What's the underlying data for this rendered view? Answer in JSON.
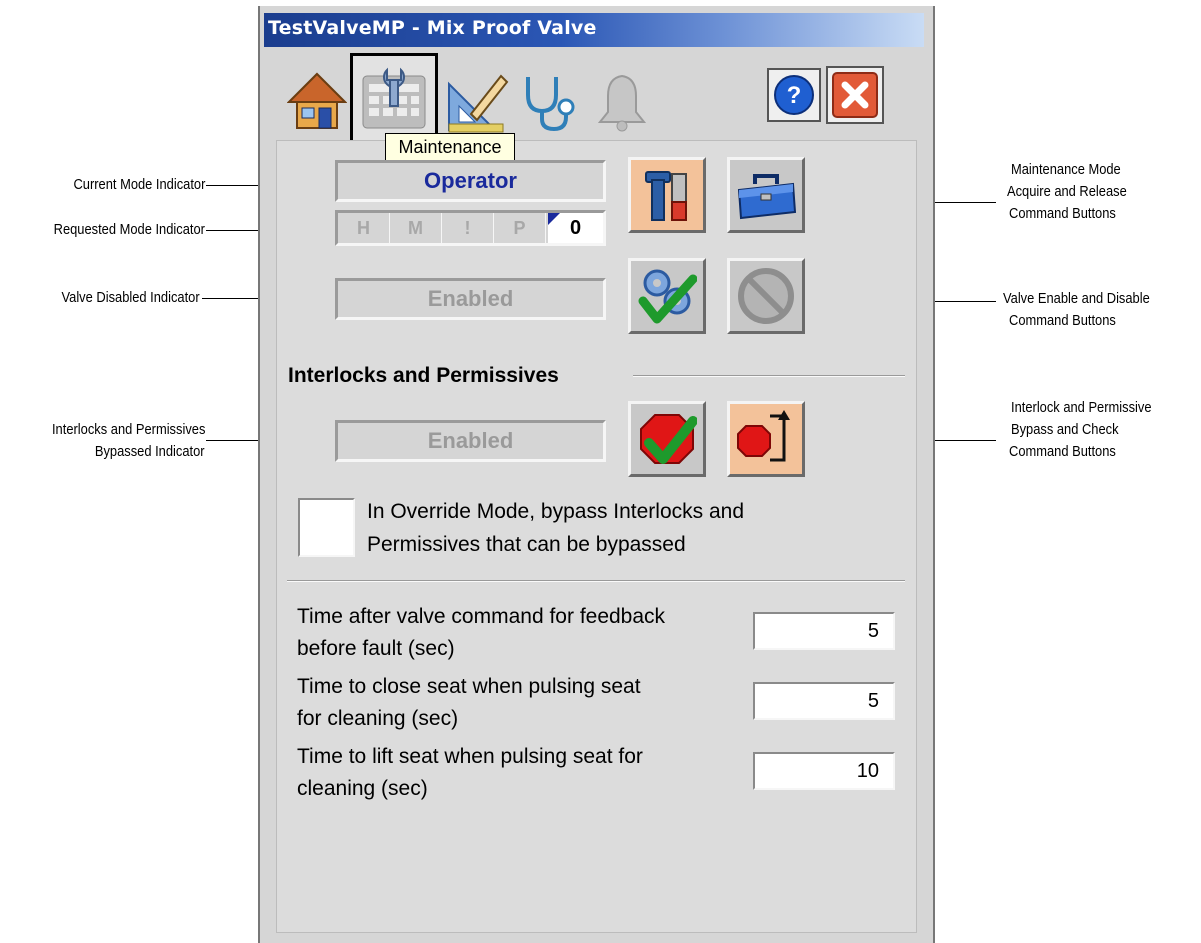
{
  "window": {
    "title": "TestValveMP - Mix Proof Valve"
  },
  "tabs": [
    {
      "name": "home",
      "icon": "home-icon"
    },
    {
      "name": "maintenance",
      "icon": "maintenance-icon",
      "selected": true
    },
    {
      "name": "engineering",
      "icon": "engineering-icon"
    },
    {
      "name": "diagnostics",
      "icon": "stethoscope-icon"
    },
    {
      "name": "alarms",
      "icon": "bell-icon"
    }
  ],
  "tooltip": "Maintenance",
  "mode": {
    "current": "Operator",
    "requested": {
      "cells": [
        "H",
        "M",
        "!",
        "P"
      ],
      "value": "0"
    }
  },
  "valve": {
    "status": "Enabled"
  },
  "interlocks": {
    "heading": "Interlocks and Permissives",
    "status": "Enabled",
    "override_label_line1": "In Override Mode, bypass Interlocks and",
    "override_label_line2": "Permissives that can be bypassed",
    "override_checked": false
  },
  "config": [
    {
      "label_line1": "Time after valve command for feedback",
      "label_line2": "before fault (sec)",
      "value": "5"
    },
    {
      "label_line1": "Time to close seat when pulsing seat",
      "label_line2": "for cleaning (sec)",
      "value": "5"
    },
    {
      "label_line1": "Time to lift seat when pulsing seat for",
      "label_line2": "cleaning (sec)",
      "value": "10"
    }
  ],
  "callouts": {
    "current_mode": "Current Mode Indicator",
    "requested_mode": "Requested Mode Indicator",
    "valve_disabled": "Valve Disabled Indicator",
    "bypassed_line1": "Interlocks and Permissives",
    "bypassed_line2": "Bypassed Indicator",
    "maint_line1": "Maintenance Mode",
    "maint_line2": "Acquire and Release",
    "maint_line3": "Command Buttons",
    "enable_line1": "Valve Enable and Disable",
    "enable_line2": "Command Buttons",
    "bypass_line1": "Interlock and Permissive",
    "bypass_line2": "Bypass and Check",
    "bypass_line3": "Command Buttons"
  },
  "colors": {
    "current_mode_text": "#1a2a9c",
    "title_bar_start": "#1b3d8e",
    "cmd_orange": "#f3c29a",
    "cmd_grey": "#c8c8c8"
  }
}
